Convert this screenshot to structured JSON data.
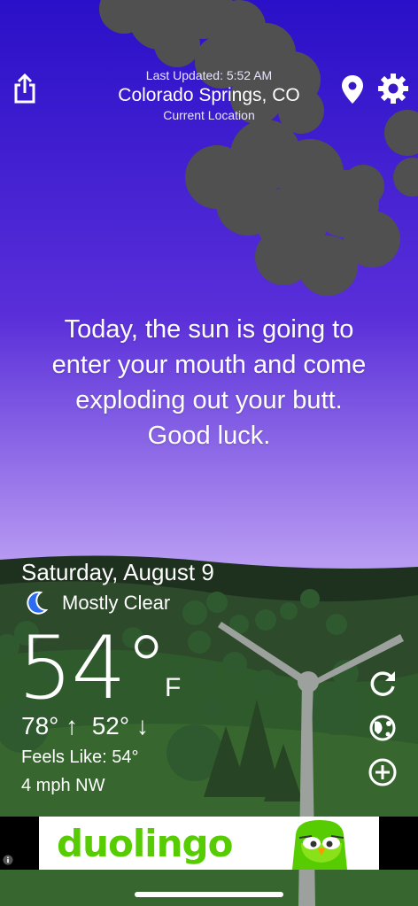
{
  "header": {
    "last_updated": "Last Updated: 5:52 AM",
    "city": "Colorado Springs, CO",
    "location_label": "Current Location"
  },
  "message": {
    "line1": "Today, the sun is going to",
    "line2": "enter your mouth and come",
    "line3": "exploding out your butt.",
    "line4": "Good luck."
  },
  "weather": {
    "date": "Saturday, August 9",
    "condition": "Mostly Clear",
    "temperature": "54°",
    "unit": "F",
    "high": "78°",
    "low": "52°",
    "feels_like": "Feels Like: 54°",
    "wind": "4 mph NW"
  },
  "ad": {
    "brand": "duolingo",
    "brand_color": "#58cc02"
  },
  "icons": [
    "share-icon",
    "location-pin-icon",
    "settings-gear-icon",
    "moon-icon",
    "refresh-icon",
    "radar-icon",
    "add-icon",
    "ad-info-icon"
  ],
  "colors": {
    "sky_top": "#2a10c8",
    "sky_mid": "#6a3ae0",
    "sky_bottom": "#b79af2",
    "hills": "#2c4a2c",
    "cloud": "#505050"
  }
}
